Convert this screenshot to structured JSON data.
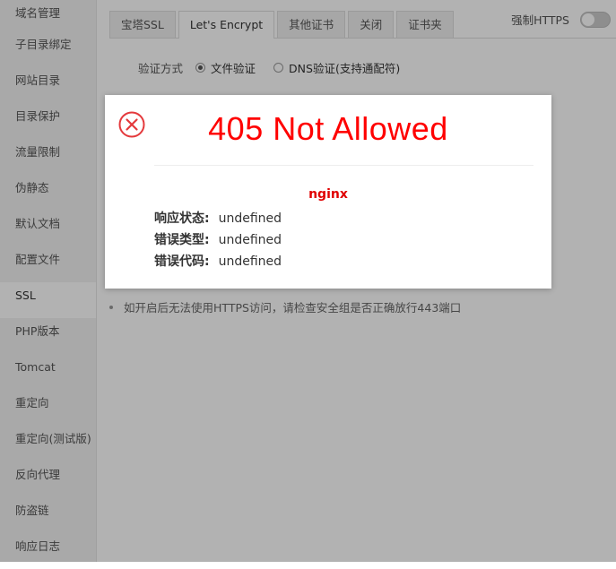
{
  "sidebar": {
    "items": [
      {
        "label": "域名管理"
      },
      {
        "label": "子目录绑定"
      },
      {
        "label": "网站目录"
      },
      {
        "label": "目录保护"
      },
      {
        "label": "流量限制"
      },
      {
        "label": "伪静态"
      },
      {
        "label": "默认文档"
      },
      {
        "label": "配置文件"
      },
      {
        "label": "SSL",
        "active": true
      },
      {
        "label": "PHP版本"
      },
      {
        "label": "Tomcat"
      },
      {
        "label": "重定向"
      },
      {
        "label": "重定向(测试版)"
      },
      {
        "label": "反向代理"
      },
      {
        "label": "防盗链"
      },
      {
        "label": "响应日志"
      }
    ]
  },
  "tabs": [
    {
      "label": "宝塔SSL"
    },
    {
      "label": "Let's Encrypt",
      "active": true
    },
    {
      "label": "其他证书"
    },
    {
      "label": "关闭"
    },
    {
      "label": "证书夹"
    }
  ],
  "force_https": {
    "label": "强制HTTPS",
    "enabled": false
  },
  "verify": {
    "label": "验证方式",
    "options": [
      {
        "label": "文件验证",
        "checked": true
      },
      {
        "label": "DNS验证(支持通配符)",
        "checked": false
      }
    ]
  },
  "tip": "如开启后无法使用HTTPS访问，请检查安全组是否正确放行443端口",
  "error_dialog": {
    "title": "405 Not Allowed",
    "server": "nginx",
    "rows": [
      {
        "key": "响应状态:",
        "value": "undefined"
      },
      {
        "key": "错误类型:",
        "value": "undefined"
      },
      {
        "key": "错误代码:",
        "value": "undefined"
      }
    ]
  },
  "colors": {
    "error_red": "#ff0000",
    "overlay": "rgba(0,0,0,0.3)"
  }
}
